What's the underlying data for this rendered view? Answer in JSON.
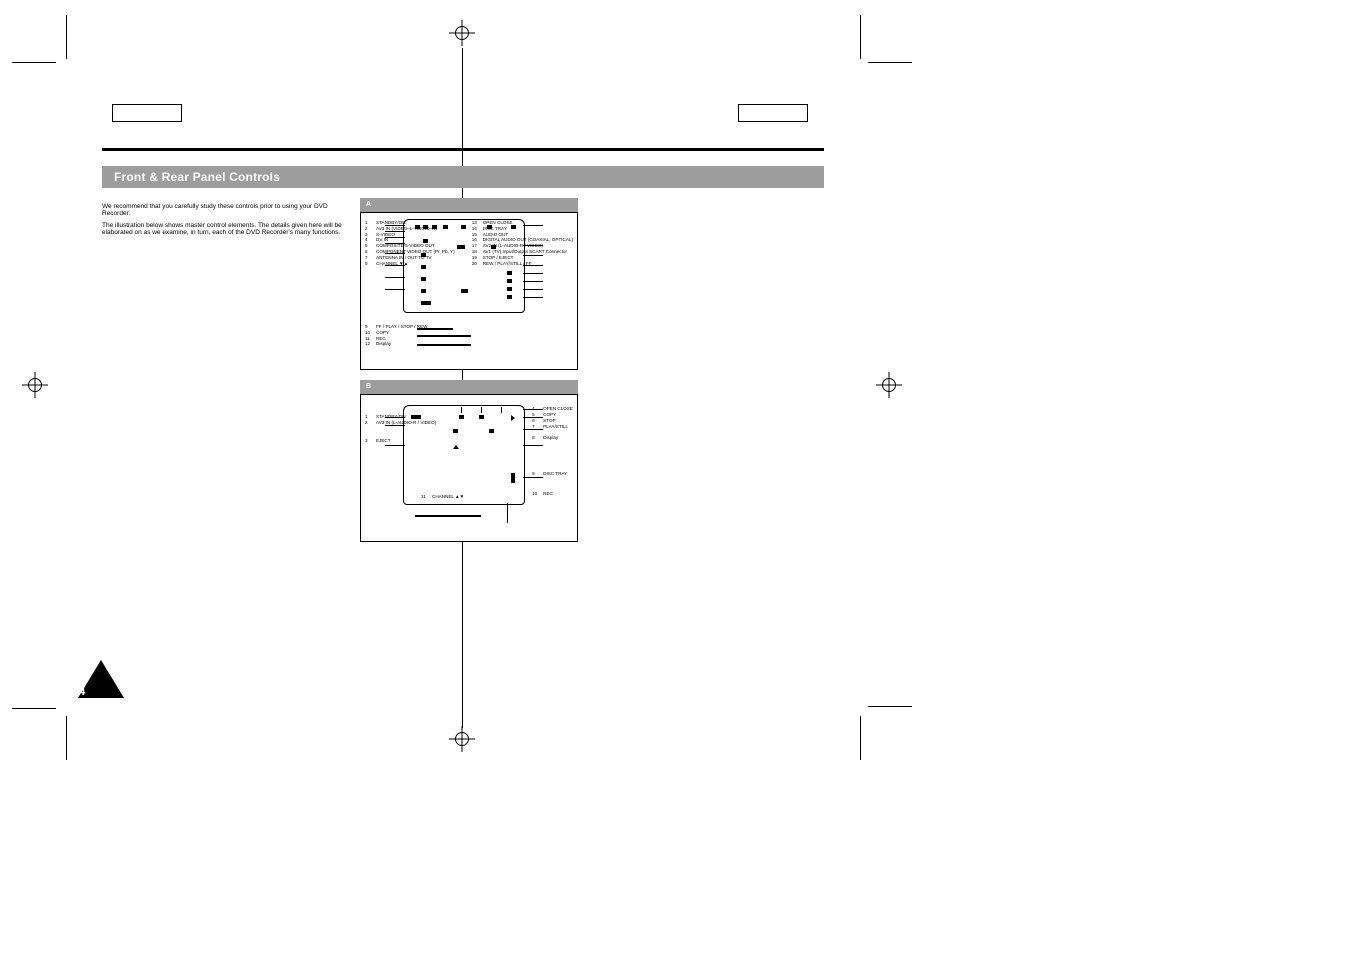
{
  "header": {
    "title": "Front & Rear Panel Controls"
  },
  "intro": [
    "We recommend that you carefully study these controls prior to using your DVD Recorder.",
    "The illustration below shows master control elements. The details given here will be elaborated on as we examine, in turn, each of the DVD Recorder's many functions."
  ],
  "fig_a": {
    "label": "A",
    "left_callouts": [
      {
        "n": "1",
        "t": "STANDBY/ON"
      },
      {
        "n": "2",
        "t": "AV3 IN (VIDEO–L–AUDIO–R)"
      },
      {
        "n": "3",
        "t": "S-VIDEO"
      },
      {
        "n": "4",
        "t": "DV IN"
      },
      {
        "n": "5",
        "t": "COMPOSITE/S-VIDEO OUT"
      },
      {
        "n": "6",
        "t": "COMPONENT VIDEO OUT (Pr, Pb, Y)"
      },
      {
        "n": "7",
        "t": "ANTENNA IN / OUT TO TV"
      },
      {
        "n": "8",
        "t": "CHANNEL ▼▲"
      },
      {
        "n": "9",
        "t": "FF / PLAY / STOP / REW"
      },
      {
        "n": "10",
        "t": "COPY"
      },
      {
        "n": "11",
        "t": "REC"
      },
      {
        "n": "12",
        "t": "Display"
      }
    ],
    "right_callouts": [
      {
        "n": "13",
        "t": "OPEN CLOSE"
      },
      {
        "n": "14",
        "t": "DISC TRAY"
      },
      {
        "n": "15",
        "t": "AUDIO OUT"
      },
      {
        "n": "16",
        "t": "DIGITAL AUDIO OUT (COAXIAL, OPTICAL)"
      },
      {
        "n": "17",
        "t": "AV2 IN (L-AUDIO-R / VIDEO)"
      },
      {
        "n": "18",
        "t": "AV1 (TV) Input/Output SCART Connector"
      },
      {
        "n": "19",
        "t": "STOP / EJECT"
      },
      {
        "n": "20",
        "t": "REW / PLAY/STILL / FF"
      }
    ]
  },
  "fig_b": {
    "label": "B",
    "left_callouts": [
      {
        "n": "1",
        "t": "STANDBY/ON"
      },
      {
        "n": "2",
        "t": "AV3 IN (L-AUDIO-R / VIDEO)"
      },
      {
        "n": "3",
        "t": "EJECT"
      }
    ],
    "right_callouts": [
      {
        "n": "4",
        "t": "OPEN CLOSE"
      },
      {
        "n": "5",
        "t": "COPY"
      },
      {
        "n": "6",
        "t": "STOP"
      },
      {
        "n": "7",
        "t": "PLAY/STILL"
      },
      {
        "n": "8",
        "t": "Display"
      },
      {
        "n": "9",
        "t": "DISC TRAY"
      },
      {
        "n": "10",
        "t": "REC"
      }
    ],
    "bottom": [
      {
        "n": "11",
        "t": "CHANNEL ▲▼"
      }
    ]
  },
  "page_numbers": {
    "left": "4"
  }
}
